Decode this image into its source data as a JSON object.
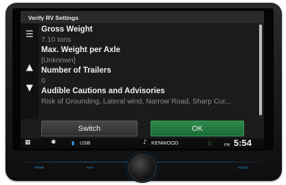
{
  "screen": {
    "title": "Verify RV Settings",
    "items": [
      {
        "label": "Gross Weight",
        "value": "7.10  tons"
      },
      {
        "label": "Max. Weight per Axle",
        "value": "[Unknown]"
      },
      {
        "label": "Number of Trailers",
        "value": "0"
      },
      {
        "label": "Audible Cautions and Advisories",
        "value": "Risk of Grounding, Lateral wind, Narrow Road, Sharp Cur..."
      }
    ],
    "buttons": {
      "switch": "Switch",
      "ok": "OK"
    }
  },
  "statusbar": {
    "source": "USB",
    "brand": "KENWOOD",
    "ampm": "PM",
    "time": "5:54"
  },
  "hardware": {
    "home": "HOME",
    "nav": "NAV",
    "voice": "VOICE"
  },
  "colors": {
    "accent": "#f2b84a",
    "ok_green": "#1f7a3c",
    "hardware_blue": "#2e9adf"
  }
}
